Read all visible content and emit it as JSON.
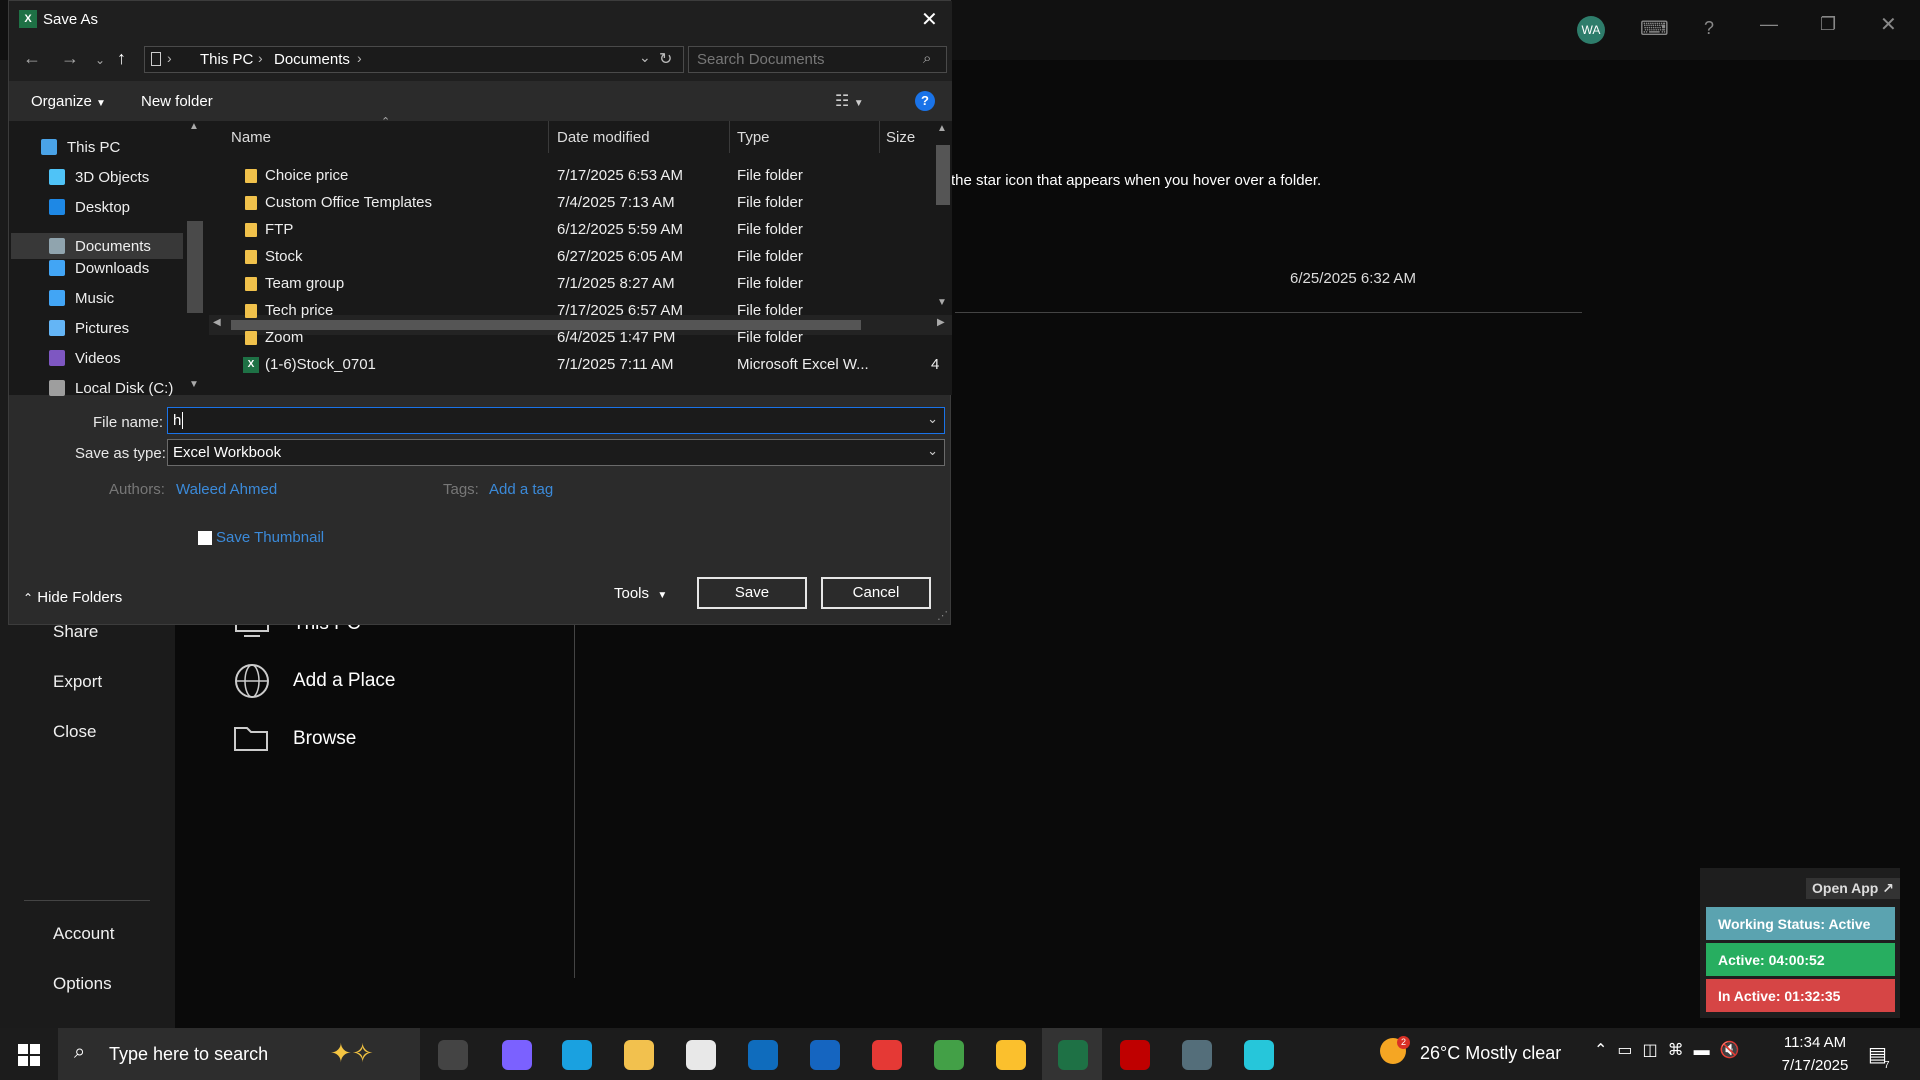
{
  "window": {
    "title": "Save As",
    "user_initials": "WA"
  },
  "background": {
    "hint_text": "the star icon that appears when you hover over a folder.",
    "recent_date": "6/25/2025 6:32 AM",
    "nav": {
      "share": "Share",
      "export": "Export",
      "close": "Close",
      "account": "Account",
      "options": "Options"
    },
    "places": {
      "this_pc": "This PC",
      "add_place": "Add a Place",
      "browse": "Browse"
    }
  },
  "dialog": {
    "breadcrumb": [
      "This PC",
      "Documents"
    ],
    "search_placeholder": "Search Documents",
    "toolbar": {
      "organize": "Organize",
      "new_folder": "New folder"
    },
    "navpane": [
      {
        "label": "This PC",
        "icon": "pc-icon",
        "color": "#4aa3e8"
      },
      {
        "label": "3D Objects",
        "icon": "cube-icon",
        "color": "#4fc3f7"
      },
      {
        "label": "Desktop",
        "icon": "desktop-icon",
        "color": "#1e88e5"
      },
      {
        "label": "Documents",
        "icon": "document-icon",
        "color": "#90a4ae"
      },
      {
        "label": "Downloads",
        "icon": "download-icon",
        "color": "#42a5f5"
      },
      {
        "label": "Music",
        "icon": "music-icon",
        "color": "#42a5f5"
      },
      {
        "label": "Pictures",
        "icon": "picture-icon",
        "color": "#64b5f6"
      },
      {
        "label": "Videos",
        "icon": "video-icon",
        "color": "#7e57c2"
      },
      {
        "label": "Local Disk (C:)",
        "icon": "disk-icon",
        "color": "#9e9e9e"
      }
    ],
    "columns": {
      "name": "Name",
      "date": "Date modified",
      "type": "Type",
      "size": "Size"
    },
    "files": [
      {
        "name": "Choice price",
        "date": "7/17/2025 6:53 AM",
        "type": "File folder",
        "size": "",
        "kind": "folder"
      },
      {
        "name": "Custom Office Templates",
        "date": "7/4/2025 7:13 AM",
        "type": "File folder",
        "size": "",
        "kind": "folder"
      },
      {
        "name": "FTP",
        "date": "6/12/2025 5:59 AM",
        "type": "File folder",
        "size": "",
        "kind": "folder"
      },
      {
        "name": "Stock",
        "date": "6/27/2025 6:05 AM",
        "type": "File folder",
        "size": "",
        "kind": "folder"
      },
      {
        "name": "Team group",
        "date": "7/1/2025 8:27 AM",
        "type": "File folder",
        "size": "",
        "kind": "folder"
      },
      {
        "name": "Tech price",
        "date": "7/17/2025 6:57 AM",
        "type": "File folder",
        "size": "",
        "kind": "folder"
      },
      {
        "name": "Zoom",
        "date": "6/4/2025 1:47 PM",
        "type": "File folder",
        "size": "",
        "kind": "folder"
      },
      {
        "name": "(1-6)Stock_0701",
        "date": "7/1/2025 7:11 AM",
        "type": "Microsoft Excel W...",
        "size": "4",
        "kind": "excel"
      }
    ],
    "file_name_label": "File name:",
    "file_name_value": "h",
    "save_type_label": "Save as type:",
    "save_type_value": "Excel Workbook",
    "authors_label": "Authors:",
    "authors_value": "Waleed Ahmed",
    "tags_label": "Tags:",
    "tags_value": "Add a tag",
    "thumbnail_label": "Save Thumbnail",
    "hide_folders": "Hide Folders",
    "tools": "Tools",
    "save": "Save",
    "cancel": "Cancel"
  },
  "status_widget": {
    "open_app": "Open App ↗",
    "working": "Working Status: Active",
    "active": "Active: 04:00:52",
    "inactive": "In Active: 01:32:35",
    "colors": {
      "working": "#5ba3b0",
      "active": "#27ae60",
      "inactive": "#d64545"
    }
  },
  "taskbar": {
    "search_placeholder": "Type here to search",
    "weather_badge": "2",
    "weather": "26°C  Mostly clear",
    "time": "11:34 AM",
    "date": "7/17/2025",
    "notification_count": "7",
    "apps": [
      {
        "name": "task-view-icon",
        "color": "#444"
      },
      {
        "name": "copilot-icon",
        "color": "#7b61ff"
      },
      {
        "name": "edge-icon",
        "color": "#1aa1e0"
      },
      {
        "name": "file-explorer-icon",
        "color": "#f2c14e"
      },
      {
        "name": "store-icon",
        "color": "#e8e8e8"
      },
      {
        "name": "outlook-icon",
        "color": "#0f6cbd"
      },
      {
        "name": "calendar-app-icon",
        "color": "#1565c0"
      },
      {
        "name": "chrome-icon",
        "color": "#e53935"
      },
      {
        "name": "chrome-profile-icon",
        "color": "#43a047"
      },
      {
        "name": "chrome-alt-icon",
        "color": "#fbc02d"
      },
      {
        "name": "excel-icon",
        "color": "#1e7145"
      },
      {
        "name": "filezilla-icon",
        "color": "#bf0000"
      },
      {
        "name": "calculator-icon",
        "color": "#546e7a"
      },
      {
        "name": "app-icon",
        "color": "#26c6da"
      }
    ]
  }
}
